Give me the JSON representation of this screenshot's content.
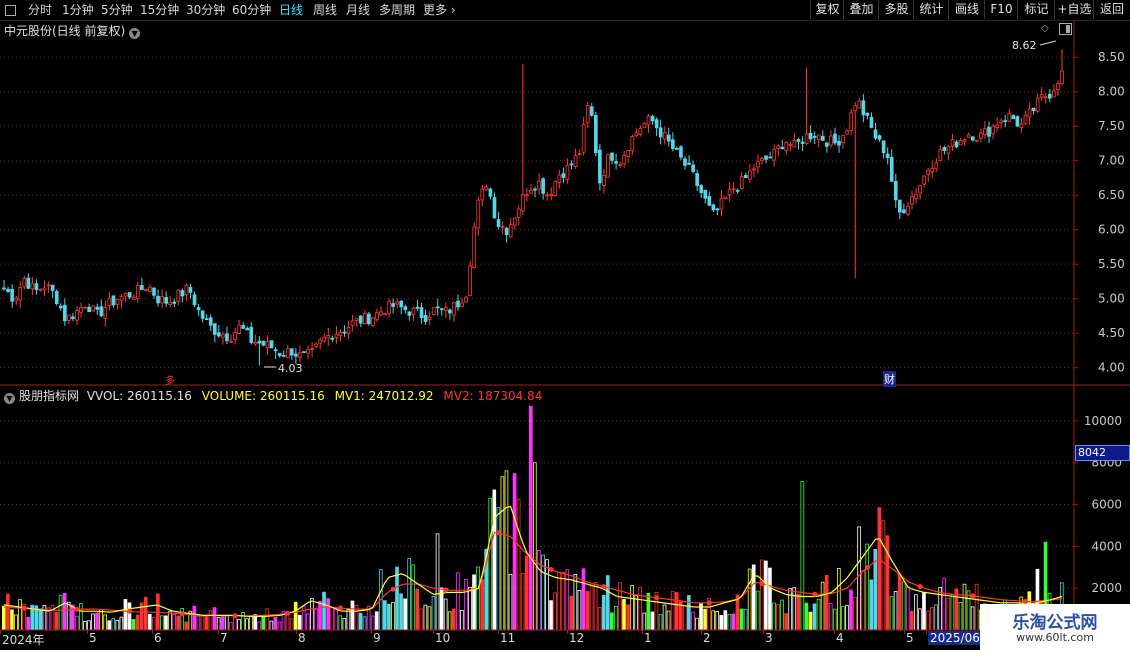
{
  "toolbar": {
    "periods": [
      {
        "label": "分时",
        "active": false
      },
      {
        "label": "1分钟",
        "active": false
      },
      {
        "label": "5分钟",
        "active": false
      },
      {
        "label": "15分钟",
        "active": false
      },
      {
        "label": "30分钟",
        "active": false
      },
      {
        "label": "60分钟",
        "active": false
      },
      {
        "label": "日线",
        "active": true
      },
      {
        "label": "周线",
        "active": false
      },
      {
        "label": "月线",
        "active": false
      },
      {
        "label": "多周期",
        "active": false
      },
      {
        "label": "更多",
        "active": false
      }
    ],
    "more_arrow": "›",
    "right_buttons": [
      "复权",
      "叠加",
      "多股",
      "统计",
      "画线",
      "F10",
      "标记",
      "+自选",
      "返回"
    ]
  },
  "price_panel": {
    "title": "中元股份(日线 前复权)",
    "title_icon": "chevron-down-icon",
    "high_label": "8.62",
    "low_label": "4.03",
    "y_ticks": [
      "8.50",
      "8.00",
      "7.50",
      "7.00",
      "6.50",
      "6.00",
      "5.50",
      "5.00",
      "4.50",
      "4.00"
    ],
    "marker_left": "多",
    "marker_right": "财"
  },
  "volume_panel": {
    "indicator_name": "股朋指标网",
    "vvol_text": "VVOL: 260115.16",
    "volume_text": "VOLUME: 260115.16",
    "mv1_text": "MV1: 247012.92",
    "mv2_text": "MV2: 187304.84",
    "y_ticks": [
      "10000",
      "8000",
      "6000",
      "4000",
      "2000"
    ],
    "current_value": "8042"
  },
  "date_axis": {
    "labels": [
      "2024年",
      "5",
      "6",
      "7",
      "8",
      "9",
      "10",
      "11",
      "12",
      "1",
      "2",
      "3",
      "4",
      "5",
      "2025/06/"
    ]
  },
  "watermark": {
    "title": "乐淘公式网",
    "url": "www.60lt.com"
  },
  "colors": {
    "up": "#ff3a3a",
    "down": "#54d6e8",
    "mv1": "#ffff33",
    "mv2": "#ff3333",
    "active_tab": "#40e0ff",
    "grid": "#7a1a1a"
  },
  "chart_data": [
    {
      "type": "candlestick",
      "title": "中元股份(日线 前复权)",
      "ylim": [
        3.85,
        8.75
      ],
      "y_ticks": [
        8.5,
        8.0,
        7.5,
        7.0,
        6.5,
        6.0,
        5.5,
        5.0,
        4.5,
        4.0
      ],
      "annotations": [
        {
          "text": "8.62",
          "value": 8.62
        },
        {
          "text": "4.03",
          "value": 4.03
        }
      ],
      "close_path": [
        5.15,
        5.0,
        5.3,
        5.1,
        5.2,
        5.05,
        4.7,
        4.8,
        4.95,
        4.75,
        4.9,
        5.0,
        5.05,
        5.1,
        5.2,
        5.0,
        4.95,
        5.05,
        5.15,
        4.8,
        4.6,
        4.5,
        4.45,
        4.6,
        4.4,
        4.35,
        4.3,
        4.2,
        4.25,
        4.15,
        4.2,
        4.4,
        4.5,
        4.55,
        4.65,
        4.7,
        4.75,
        4.85,
        4.9,
        4.85,
        4.8,
        4.75,
        4.85,
        4.8,
        4.9,
        5.1,
        6.3,
        6.7,
        6.1,
        6.0,
        6.3,
        6.6,
        6.7,
        6.5,
        6.8,
        6.9,
        7.1,
        7.9,
        6.7,
        7.1,
        7.0,
        7.3,
        7.5,
        7.6,
        7.4,
        7.2,
        7.0,
        6.8,
        6.5,
        6.2,
        6.4,
        6.6,
        6.7,
        6.9,
        7.0,
        7.1,
        7.3,
        7.2,
        7.35,
        7.4,
        7.3,
        7.25,
        7.45,
        7.9,
        7.6,
        7.3,
        7.1,
        6.2,
        6.4,
        6.6,
        6.9,
        7.1,
        7.2,
        7.3,
        7.4,
        7.35,
        7.45,
        7.6,
        7.65,
        7.5,
        7.7,
        7.9,
        8.0,
        8.3
      ]
    },
    {
      "type": "bar",
      "title": "股朋指标网",
      "ylim": [
        0,
        11000
      ],
      "y_ticks": [
        10000,
        8000,
        6000,
        4000,
        2000
      ],
      "series": [
        {
          "name": "MV1",
          "color": "#ffff33"
        },
        {
          "name": "MV2",
          "color": "#ff3333"
        }
      ],
      "mv1_path": [
        1200,
        1100,
        1000,
        900,
        1300,
        900,
        900,
        850,
        1000,
        1100,
        1200,
        900,
        800,
        700,
        700,
        700,
        650,
        650,
        700,
        900,
        1400,
        1200,
        900,
        900,
        1000,
        2500,
        2700,
        2200,
        1700,
        1800,
        1800,
        2000,
        5400,
        6000,
        3800,
        2800,
        2500,
        2400,
        2200,
        2000,
        1600,
        1500,
        1400,
        1300,
        1200,
        1100,
        1100,
        1300,
        1500,
        2700,
        2000,
        1700,
        1600,
        1600,
        1800,
        2500,
        3500,
        4500,
        3200,
        2000,
        1800,
        1700,
        1600,
        1500,
        1400,
        1300,
        1300,
        1250,
        1400,
        1600
      ],
      "mv2_path": [
        1100,
        1050,
        1000,
        950,
        950,
        1000,
        1000,
        950,
        900,
        850,
        850,
        800,
        750,
        700,
        700,
        680,
        680,
        700,
        750,
        850,
        1000,
        1100,
        1050,
        1000,
        1000,
        1800,
        2200,
        2200,
        2000,
        1900,
        1900,
        2000,
        4700,
        4500,
        3700,
        3100,
        2800,
        2600,
        2300,
        2100,
        1900,
        1700,
        1600,
        1500,
        1400,
        1300,
        1300,
        1350,
        1500,
        2300,
        2100,
        1900,
        1800,
        1700,
        1750,
        2000,
        2800,
        3400,
        2900,
        2300,
        2000,
        1800,
        1700,
        1650,
        1550,
        1450,
        1400,
        1350,
        1400,
        1500
      ]
    }
  ]
}
